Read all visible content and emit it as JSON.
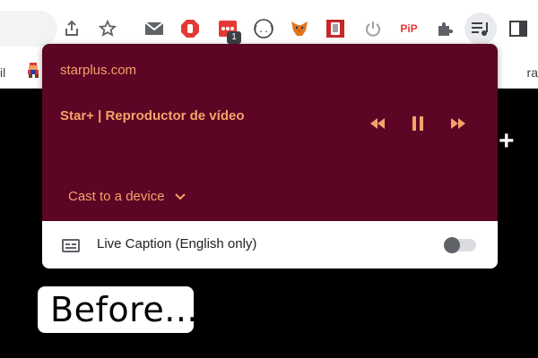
{
  "bookmarks": {
    "left_text": "il",
    "right_text": "ra"
  },
  "extensions": {
    "badge_count": "1",
    "pip_label": "PiP"
  },
  "media": {
    "site": "starplus.com",
    "title": "Star+ | Reproductor de vídeo",
    "cast_label": "Cast to a device"
  },
  "caption": {
    "label": "Live Caption (English only)",
    "enabled": false
  },
  "page": {
    "before_text": "Before...",
    "plus_label": "+"
  },
  "colors": {
    "media_bg": "#5c0524",
    "media_fg": "#f5a26a",
    "page_bg": "#000000"
  },
  "icons": [
    "share-icon",
    "star-icon",
    "mail-icon",
    "stop-hand-icon",
    "dots-extension-icon",
    "json-braces-icon",
    "metamask-fox-icon",
    "tablet-icon",
    "power-icon",
    "pip-icon",
    "puzzle-icon",
    "media-queue-icon",
    "side-panel-icon",
    "rewind-icon",
    "pause-icon",
    "fast-forward-icon",
    "chevron-down-icon",
    "captions-icon"
  ]
}
